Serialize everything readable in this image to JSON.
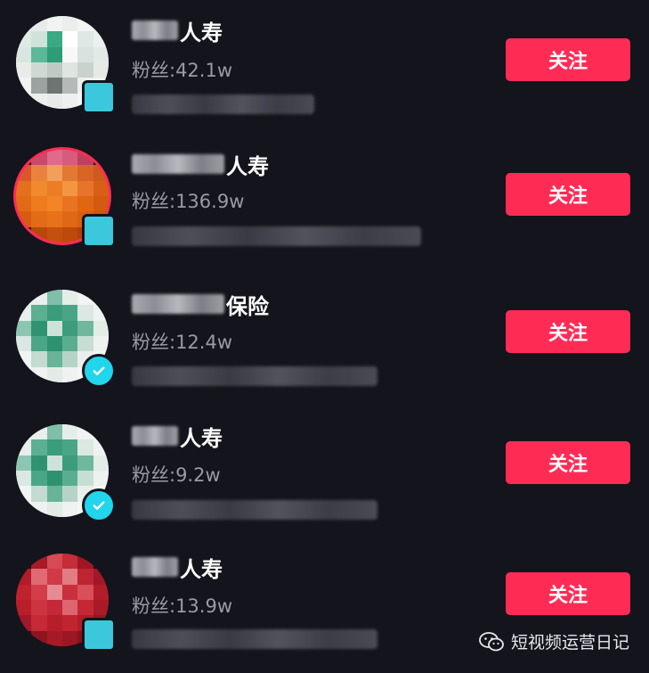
{
  "accounts": [
    {
      "name_suffix": "人寿",
      "fans": "粉丝:42.1w",
      "follow_label": "关注"
    },
    {
      "name_suffix": "人寿",
      "fans": "粉丝:136.9w",
      "follow_label": "关注"
    },
    {
      "name_suffix": "保险",
      "fans": "粉丝:12.4w",
      "follow_label": "关注"
    },
    {
      "name_suffix": "人寿",
      "fans": "粉丝:9.2w",
      "follow_label": "关注"
    },
    {
      "name_suffix": "人寿",
      "fans": "粉丝:13.9w",
      "follow_label": "关注"
    }
  ],
  "watermark": {
    "text": "短视频运营日记",
    "icon": "wechat-icon"
  },
  "colors": {
    "background": "#14141c",
    "follow_button": "#fe2c55",
    "verified_badge": "#20d5ec",
    "fans_text": "#9a9aa3"
  }
}
